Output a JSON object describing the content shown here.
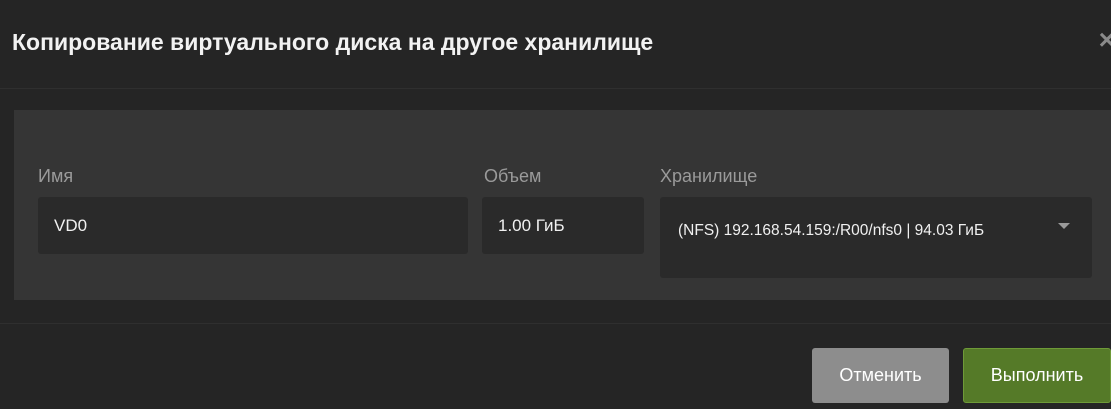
{
  "dialog": {
    "title": "Копирование виртуального диска на другое хранилище",
    "close_glyph": "×"
  },
  "form": {
    "name_label": "Имя",
    "name_value": "VD0",
    "size_label": "Объем",
    "size_value": "1.00 ГиБ",
    "storage_label": "Хранилище",
    "storage_value": "(NFS) 192.168.54.159:/R00/nfs0 | 94.03 ГиБ"
  },
  "buttons": {
    "cancel_label": "Отменить",
    "run_label": "Выполнить"
  },
  "colors": {
    "primary": "#557a28",
    "secondary": "#8d8d8d",
    "background": "#252525",
    "panel": "#353535"
  }
}
